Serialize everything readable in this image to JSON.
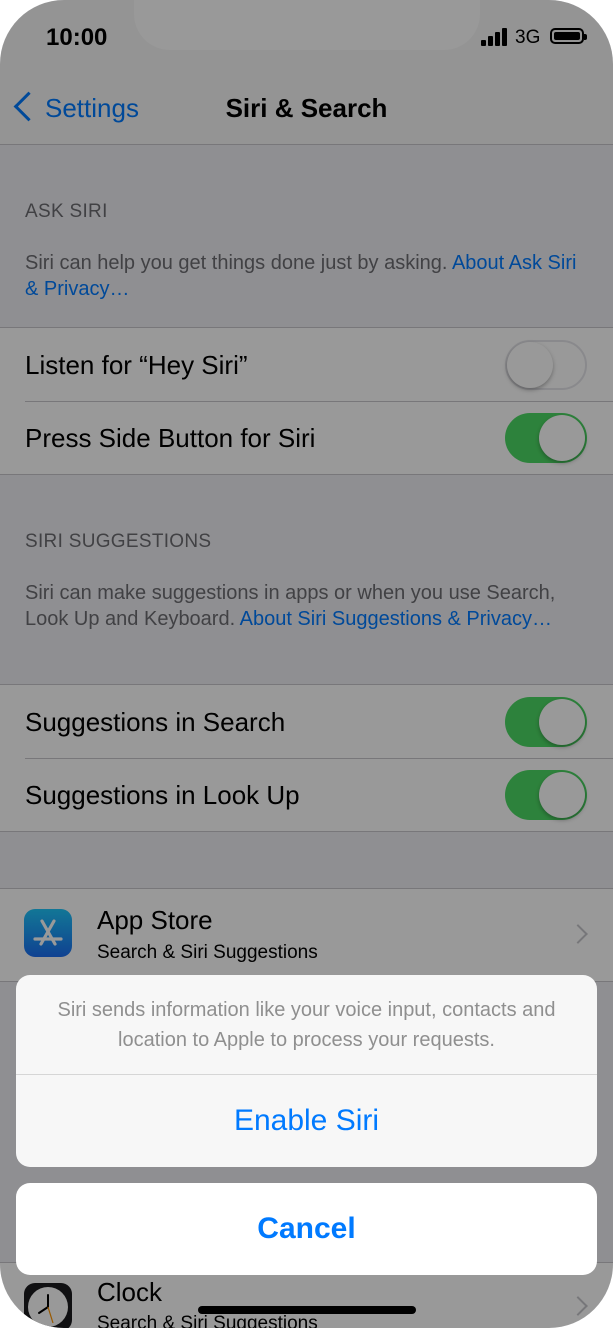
{
  "status_bar": {
    "time": "10:00",
    "network": "3G"
  },
  "nav": {
    "back_label": "Settings",
    "title": "Siri & Search"
  },
  "ask_siri": {
    "header": "ASK SIRI",
    "footer_text": "Siri can help you get things done just by asking. ",
    "footer_link": "About Ask Siri & Privacy…",
    "rows": [
      {
        "label": "Listen for “Hey Siri”",
        "on": false
      },
      {
        "label": "Press Side Button for Siri",
        "on": true
      }
    ]
  },
  "siri_suggestions": {
    "header": "SIRI SUGGESTIONS",
    "footer_text": "Siri can make suggestions in apps or when you use Search, Look Up and Keyboard. ",
    "footer_link": "About Siri Suggestions & Privacy…",
    "rows": [
      {
        "label": "Suggestions in Search",
        "on": true
      },
      {
        "label": "Suggestions in Look Up",
        "on": true
      }
    ]
  },
  "apps": [
    {
      "name": "App Store",
      "subtitle": "Search & Siri Suggestions",
      "icon": "app-store-icon"
    },
    {
      "name": "Clock",
      "subtitle": "Search & Siri Suggestions",
      "icon": "clock-icon"
    }
  ],
  "action_sheet": {
    "message": "Siri sends information like your voice input, contacts and location to Apple to process your requests.",
    "enable_label": "Enable Siri",
    "cancel_label": "Cancel"
  },
  "colors": {
    "accent": "#007aff",
    "switch_on": "#4cd964",
    "background": "#efeff4"
  }
}
